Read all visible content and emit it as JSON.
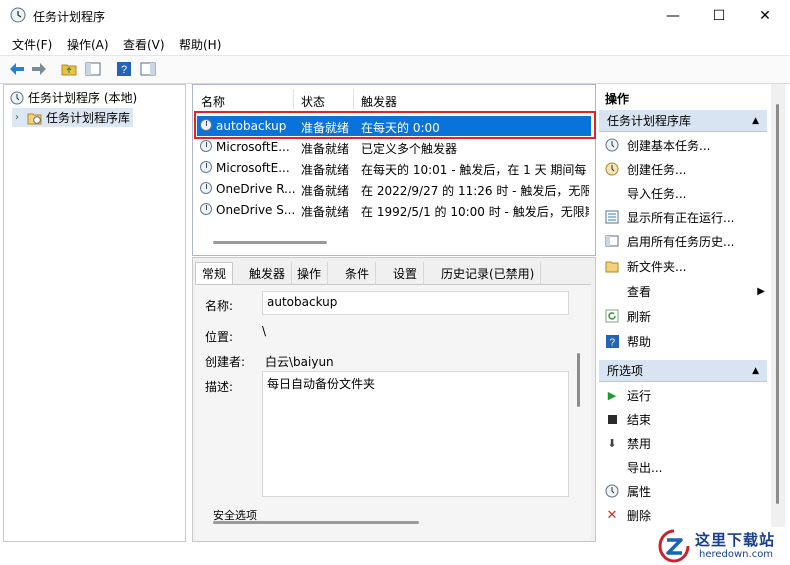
{
  "window": {
    "title": "任务计划程序",
    "minimize": "—",
    "maximize": "☐",
    "close": "✕"
  },
  "menu": [
    "文件(F)",
    "操作(A)",
    "查看(V)",
    "帮助(H)"
  ],
  "tree": {
    "root": "任务计划程序 (本地)",
    "child": "任务计划程序库"
  },
  "list": {
    "columns": [
      "名称",
      "状态",
      "触发器"
    ],
    "rows": [
      {
        "name": "autobackup",
        "status": "准备就绪",
        "trigger": "在每天的 0:00",
        "selected": true
      },
      {
        "name": "MicrosoftE...",
        "status": "准备就绪",
        "trigger": "已定义多个触发器",
        "selected": false
      },
      {
        "name": "MicrosoftE...",
        "status": "准备就绪",
        "trigger": "在每天的 10:01 - 触发后，在 1 天 期间每",
        "selected": false
      },
      {
        "name": "OneDrive R...",
        "status": "准备就绪",
        "trigger": "在 2022/9/27 的 11:26 时 - 触发后，无限期",
        "selected": false
      },
      {
        "name": "OneDrive S...",
        "status": "准备就绪",
        "trigger": "在 1992/5/1 的 10:00 时 - 触发后，无限期",
        "selected": false
      }
    ]
  },
  "detail": {
    "tabs": [
      "常规",
      "触发器",
      "操作",
      "条件",
      "设置",
      "历史记录(已禁用)"
    ],
    "name_label": "名称:",
    "name_value": "autobackup",
    "location_label": "位置:",
    "location_value": "\\",
    "author_label": "创建者:",
    "author_value": "白云\\baiyun",
    "desc_label": "描述:",
    "desc_value": "每日自动备份文件夹",
    "security_label": "安全选项"
  },
  "actions": {
    "pane_title": "操作",
    "section1_title": "任务计划程序库",
    "section1_items": [
      {
        "label": "创建基本任务...",
        "icon": "create-basic-task-icon"
      },
      {
        "label": "创建任务...",
        "icon": "create-task-icon"
      },
      {
        "label": "导入任务...",
        "icon": "none"
      },
      {
        "label": "显示所有正在运行...",
        "icon": "running-tasks-icon"
      },
      {
        "label": "启用所有任务历史...",
        "icon": "history-icon"
      },
      {
        "label": "新文件夹...",
        "icon": "folder-icon"
      },
      {
        "label": "查看",
        "icon": "none"
      },
      {
        "label": "刷新",
        "icon": "refresh-icon"
      },
      {
        "label": "帮助",
        "icon": "help-icon"
      }
    ],
    "section2_title": "所选项",
    "section2_items": [
      {
        "label": "运行",
        "icon": "run-icon"
      },
      {
        "label": "结束",
        "icon": "stop-icon"
      },
      {
        "label": "禁用",
        "icon": "disable-icon"
      },
      {
        "label": "导出...",
        "icon": "none"
      },
      {
        "label": "属性",
        "icon": "properties-icon"
      },
      {
        "label": "删除",
        "icon": "delete-icon"
      }
    ]
  },
  "watermark": {
    "name": "这里下载站",
    "url": "heredown.com"
  },
  "colors": {
    "selection": "#0a73d9",
    "highlight_border": "#e0242c",
    "action_header": "#d9e4f2"
  }
}
